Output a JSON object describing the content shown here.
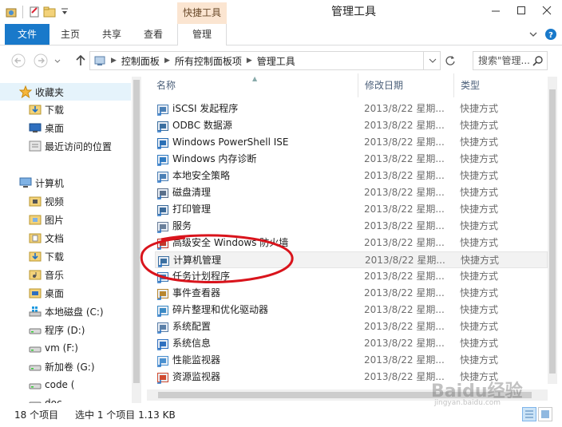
{
  "window": {
    "title": "管理工具",
    "context_tab_title": "快捷工具"
  },
  "ribbon": {
    "tabs": [
      "文件",
      "主页",
      "共享",
      "查看",
      "管理"
    ]
  },
  "address": {
    "crumbs": [
      "控制面板",
      "所有控制面板项",
      "管理工具"
    ],
    "search_placeholder": "搜索\"管理..."
  },
  "nav": {
    "favorites_label": "收藏夹",
    "favorites": [
      "下载",
      "桌面",
      "最近访问的位置"
    ],
    "computer_label": "计算机",
    "computer": [
      "视频",
      "图片",
      "文档",
      "下载",
      "音乐",
      "桌面",
      "本地磁盘 (C:)",
      "程序 (D:)",
      "vm (F:)",
      "新加卷 (G:)",
      "code (",
      "doc "
    ]
  },
  "columns": {
    "name": "名称",
    "date": "修改日期",
    "type": "类型"
  },
  "files": [
    {
      "name": "iSCSI 发起程序",
      "date": "2013/8/22 星期...",
      "type": "快捷方式"
    },
    {
      "name": "ODBC 数据源",
      "date": "2013/8/22 星期...",
      "type": "快捷方式"
    },
    {
      "name": "Windows PowerShell ISE",
      "date": "2013/8/22 星期...",
      "type": "快捷方式"
    },
    {
      "name": "Windows 内存诊断",
      "date": "2013/8/22 星期...",
      "type": "快捷方式"
    },
    {
      "name": "本地安全策略",
      "date": "2013/8/22 星期...",
      "type": "快捷方式"
    },
    {
      "name": "磁盘清理",
      "date": "2013/8/22 星期...",
      "type": "快捷方式"
    },
    {
      "name": "打印管理",
      "date": "2013/8/22 星期...",
      "type": "快捷方式"
    },
    {
      "name": "服务",
      "date": "2013/8/22 星期...",
      "type": "快捷方式"
    },
    {
      "name": "高级安全 Windows 防火墙",
      "date": "2013/8/22 星期...",
      "type": "快捷方式"
    },
    {
      "name": "计算机管理",
      "date": "2013/8/22 星期...",
      "type": "快捷方式"
    },
    {
      "name": "任务计划程序",
      "date": "2013/8/22 星期...",
      "type": "快捷方式"
    },
    {
      "name": "事件查看器",
      "date": "2013/8/22 星期...",
      "type": "快捷方式"
    },
    {
      "name": "碎片整理和优化驱动器",
      "date": "2013/8/22 星期...",
      "type": "快捷方式"
    },
    {
      "name": "系统配置",
      "date": "2013/8/22 星期...",
      "type": "快捷方式"
    },
    {
      "name": "系统信息",
      "date": "2013/8/22 星期...",
      "type": "快捷方式"
    },
    {
      "name": "性能监视器",
      "date": "2013/8/22 星期...",
      "type": "快捷方式"
    },
    {
      "name": "资源监视器",
      "date": "2013/8/22 星期...",
      "type": "快捷方式"
    }
  ],
  "status": {
    "count": "18 个项目",
    "selection": "选中 1 个项目  1.13 KB"
  },
  "watermark": {
    "brand": "Baidu经验",
    "url": "jingyan.baidu.com"
  },
  "colors": {
    "file_tab": "#1979ca",
    "context_tab": "#fbe5d1",
    "annotation": "#d9141c"
  }
}
